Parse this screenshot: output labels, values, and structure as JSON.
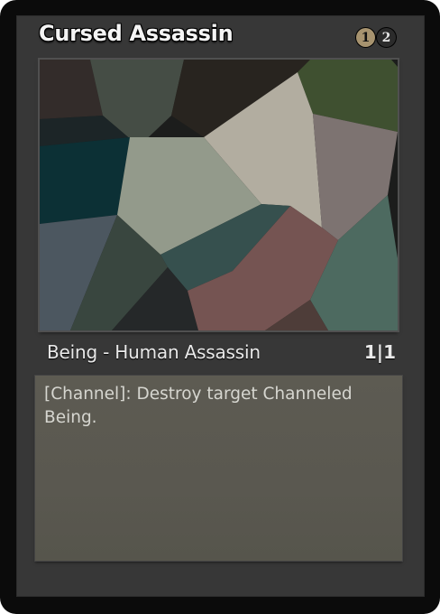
{
  "card": {
    "name": "Cursed Assassin",
    "mana_cost": [
      {
        "symbol": "1",
        "kind": "generic"
      },
      {
        "symbol": "2",
        "kind": "dark"
      }
    ],
    "type_line": "Being - Human Assassin",
    "power_toughness": "1|1",
    "rules_text": "[Channel]: Destroy target Channeled Being.",
    "art_colors": [
      "#332c2a",
      "#454d45",
      "#28241f",
      "#3f5030",
      "#1c2527",
      "#b2ada0",
      "#7d7371",
      "#0c3035",
      "#939a8b",
      "#4c5760",
      "#39463f",
      "#36504e",
      "#252829",
      "#755452",
      "#4d6a60",
      "#4e3d39",
      "#1c1d1c"
    ]
  }
}
